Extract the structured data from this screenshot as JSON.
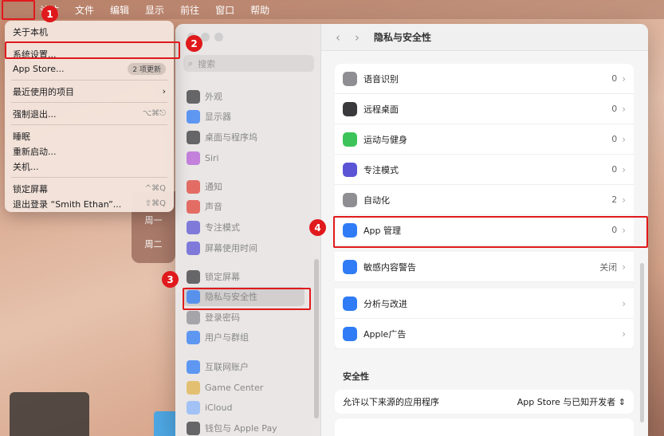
{
  "menubar": {
    "apple_icon": "apple-icon",
    "items": [
      "访达",
      "文件",
      "编辑",
      "显示",
      "前往",
      "窗口",
      "帮助"
    ]
  },
  "apple_menu": {
    "about": "关于本机",
    "settings": "系统设置...",
    "appstore": "App Store...",
    "appstore_badge": "2 项更新",
    "recent": "最近使用的项目",
    "force_quit": "强制退出...",
    "force_quit_shortcut": "⌥⌘⎋",
    "sleep": "睡眠",
    "restart": "重新启动...",
    "shutdown": "关机...",
    "lock": "锁定屏幕",
    "lock_shortcut": "^⌘Q",
    "logout": "退出登录 “Smith Ethan”...",
    "logout_shortcut": "⇧⌘Q"
  },
  "background_card": {
    "day1": "周一",
    "day2": "周二"
  },
  "sidebar": {
    "search_placeholder": "搜索",
    "items": [
      {
        "label": "外观",
        "icon": "appearance-icon",
        "color": "#3a3a3c"
      },
      {
        "label": "显示器",
        "icon": "display-icon",
        "color": "#2f7cf6"
      },
      {
        "label": "桌面与程序坞",
        "icon": "dock-icon",
        "color": "#3a3a3c"
      },
      {
        "label": "Siri",
        "icon": "siri-icon",
        "color": "#b65fd8"
      },
      {
        "label": "通知",
        "icon": "notification-icon",
        "color": "#e0443a"
      },
      {
        "label": "声音",
        "icon": "sound-icon",
        "color": "#e0443a"
      },
      {
        "label": "专注模式",
        "icon": "focus-icon",
        "color": "#5b55d6"
      },
      {
        "label": "屏幕使用时间",
        "icon": "screentime-icon",
        "color": "#5b55d6"
      },
      {
        "label": "锁定屏幕",
        "icon": "lock-icon",
        "color": "#3a3a3c"
      },
      {
        "label": "隐私与安全性",
        "icon": "hand-icon",
        "color": "#2f7cf6"
      },
      {
        "label": "登录密码",
        "icon": "password-icon",
        "color": "#8e8e93"
      },
      {
        "label": "用户与群组",
        "icon": "users-icon",
        "color": "#2f7cf6"
      },
      {
        "label": "互联网账户",
        "icon": "at-icon",
        "color": "#2f7cf6"
      },
      {
        "label": "Game Center",
        "icon": "gamecenter-icon",
        "color": "#e0b34a"
      },
      {
        "label": "iCloud",
        "icon": "icloud-icon",
        "color": "#8ab4f8"
      },
      {
        "label": "钱包与 Apple Pay",
        "icon": "wallet-icon",
        "color": "#3a3a3c"
      }
    ]
  },
  "content": {
    "title": "隐私与安全性",
    "rows": [
      {
        "label": "语音识别",
        "value": "0",
        "icon": "waveform-icon",
        "color": "#8e8e93"
      },
      {
        "label": "远程桌面",
        "value": "0",
        "icon": "binoculars-icon",
        "color": "#3a3a3c"
      },
      {
        "label": "运动与健身",
        "value": "0",
        "icon": "fitness-icon",
        "color": "#3cc45a"
      },
      {
        "label": "专注模式",
        "value": "0",
        "icon": "moon-icon",
        "color": "#5b55d6"
      },
      {
        "label": "自动化",
        "value": "2",
        "icon": "gear-icon",
        "color": "#8e8e93"
      },
      {
        "label": "App 管理",
        "value": "0",
        "icon": "appstore-icon",
        "color": "#2f7cf6"
      }
    ],
    "rows2": [
      {
        "label": "敏感内容警告",
        "value": "关闭",
        "icon": "eye-icon",
        "color": "#2f7cf6"
      }
    ],
    "rows3": [
      {
        "label": "分析与改进",
        "value": "",
        "icon": "chart-icon",
        "color": "#2f7cf6"
      },
      {
        "label": "Apple广告",
        "value": "",
        "icon": "megaphone-icon",
        "color": "#2f7cf6"
      }
    ],
    "security_title": "安全性",
    "allow_label": "允许以下来源的应用程序",
    "allow_value": "App Store 与已知开发者"
  },
  "annotations": [
    "1",
    "2",
    "3",
    "4"
  ]
}
